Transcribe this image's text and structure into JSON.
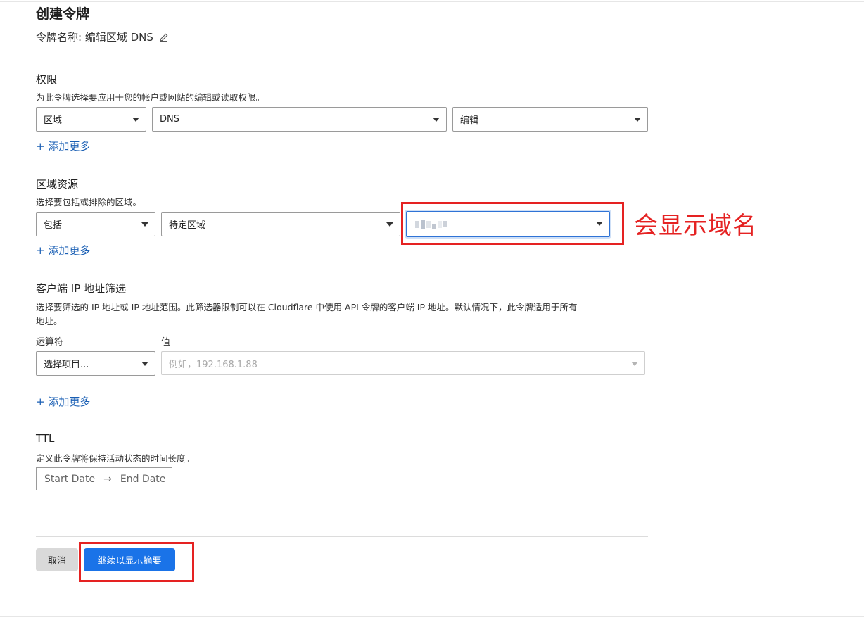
{
  "page": {
    "title": "创建令牌"
  },
  "token": {
    "name_label": "令牌名称: 编辑区域 DNS"
  },
  "permissions": {
    "heading": "权限",
    "description": "为此令牌选择要应用于您的帐户或网站的编辑或读取权限。",
    "scope_select": "区域",
    "resource_select": "DNS",
    "access_select": "编辑",
    "add_more": "+ 添加更多"
  },
  "zone_resources": {
    "heading": "区域资源",
    "description": "选择要包括或排除的区域。",
    "include_select": "包括",
    "zone_type_select": "特定区域",
    "add_more": "+ 添加更多"
  },
  "client_ip": {
    "heading": "客户端 IP 地址筛选",
    "description_line1": "选择要筛选的 IP 地址或 IP 地址范围。此筛选器限制可以在 Cloudflare 中使用 API 令牌的客户端 IP 地址。默认情况下，此令牌适用于所有",
    "description_line2": "地址。",
    "operator_label": "运算符",
    "value_label": "值",
    "operator_select": "选择项目...",
    "value_placeholder": "例如，192.168.1.88",
    "add_more": "+ 添加更多"
  },
  "ttl": {
    "heading": "TTL",
    "description": "定义此令牌将保持活动状态的时间长度。",
    "start_placeholder": "Start Date",
    "arrow": "→",
    "end_placeholder": "End Date"
  },
  "actions": {
    "cancel_label": "取消",
    "continue_label": "继续以显示摘要"
  },
  "annotation": {
    "text": "会显示域名"
  },
  "colors": {
    "accent": "#1a73e8",
    "link": "#1a5fb4",
    "annotation": "#e52222"
  }
}
